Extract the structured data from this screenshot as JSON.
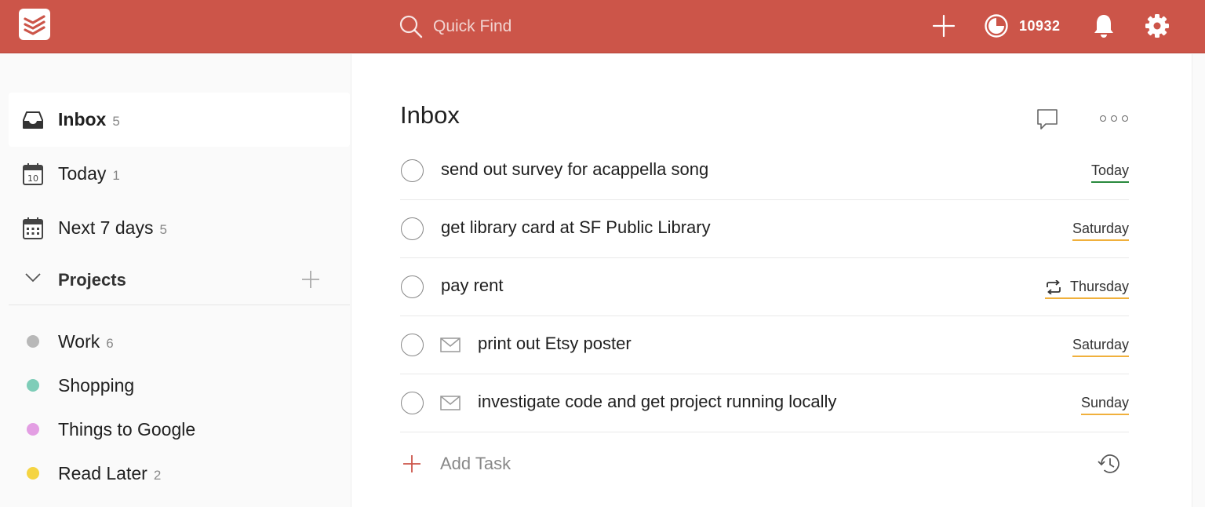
{
  "colors": {
    "brand": "#cc5549",
    "today_underline": "#2a8a3e",
    "date_underline": "#f0b03c"
  },
  "topbar": {
    "search_placeholder": "Quick Find",
    "karma_points": "10932",
    "icons": [
      "todoist-logo-icon",
      "search-icon",
      "plus-icon",
      "karma-icon",
      "bell-icon",
      "gear-icon"
    ]
  },
  "sidebar": {
    "nav": [
      {
        "label": "Inbox",
        "count": "5",
        "icon": "inbox-icon",
        "active": true
      },
      {
        "label": "Today",
        "count": "1",
        "icon": "calendar-today-icon"
      },
      {
        "label": "Next 7 days",
        "count": "5",
        "icon": "calendar-week-icon"
      }
    ],
    "projects_title": "Projects",
    "projects": [
      {
        "label": "Work",
        "count": "6",
        "color": "#b8b8b8"
      },
      {
        "label": "Shopping",
        "count": "",
        "color": "#7ecdb8"
      },
      {
        "label": "Things to Google",
        "count": "",
        "color": "#e39ee3"
      },
      {
        "label": "Read Later",
        "count": "2",
        "color": "#f5d442"
      }
    ]
  },
  "main": {
    "title": "Inbox",
    "tasks": [
      {
        "text": "send out survey for acappella song",
        "due": "Today",
        "mail": false,
        "recurring": false
      },
      {
        "text": "get library card at SF Public Library",
        "due": "Saturday",
        "mail": false,
        "recurring": false
      },
      {
        "text": "pay rent",
        "due": "Thursday",
        "mail": false,
        "recurring": true
      },
      {
        "text": "print out Etsy poster",
        "due": "Saturday",
        "mail": true,
        "recurring": false
      },
      {
        "text": "investigate code and get project running locally",
        "due": "Sunday",
        "mail": true,
        "recurring": false
      }
    ],
    "add_task_label": "Add Task"
  }
}
